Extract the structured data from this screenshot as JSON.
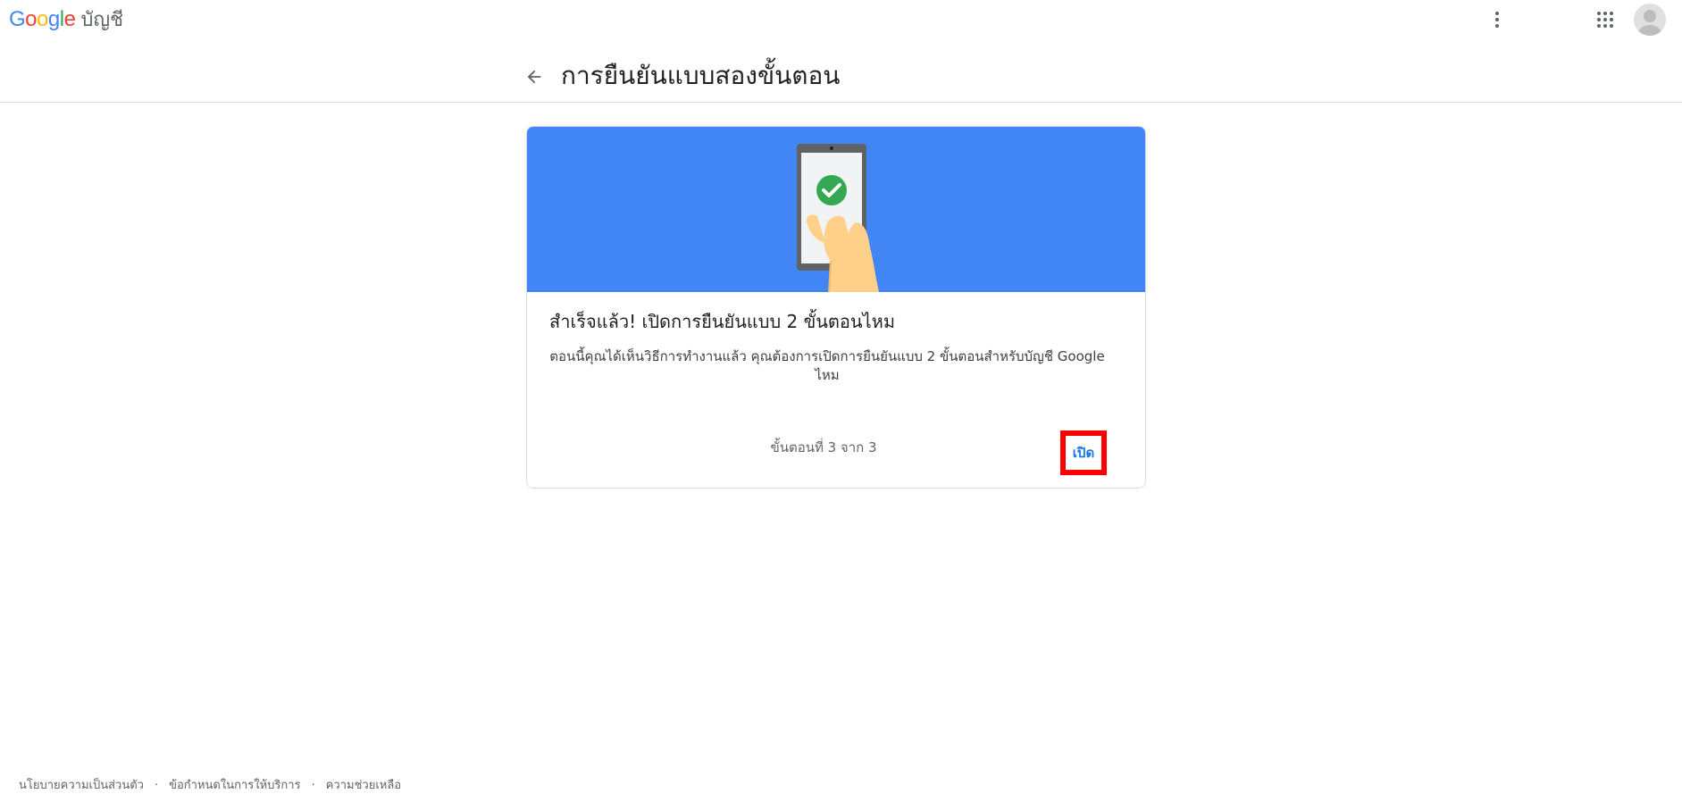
{
  "header": {
    "logo_text": "Google",
    "logo_letters": [
      "G",
      "o",
      "o",
      "g",
      "l",
      "e"
    ],
    "logo_colors": [
      "#4285f4",
      "#ea4335",
      "#fbbc05",
      "#4285f4",
      "#34a853",
      "#ea4335"
    ],
    "product_name": "บัญชี",
    "more_icon": "more-vert-icon",
    "apps_icon": "apps-grid-icon",
    "avatar_icon": "account-avatar-icon"
  },
  "title_bar": {
    "back_icon": "arrow-back-icon",
    "title": "การยืนยันแบบสองขั้นตอน"
  },
  "card": {
    "hero_color": "#4285f4",
    "hero_icon": "phone-checkmark-illustration",
    "heading": "สำเร็จแล้ว! เปิดการยืนยันแบบ 2 ขั้นตอนไหม",
    "body": "ตอนนี้คุณได้เห็นวิธีการทำงานแล้ว คุณต้องการเปิดการยืนยันแบบ 2 ขั้นตอนสำหรับบัญชี Google ไหม",
    "step_text": "ขั้นตอนที่ 3 จาก 3",
    "turn_on_label": "เปิด",
    "turn_on_color": "#1a73e8",
    "highlight_color": "#ff0000"
  },
  "footer": {
    "links": [
      "นโยบายความเป็นส่วนตัว",
      "ข้อกำหนดในการให้บริการ",
      "ความช่วยเหลือ"
    ],
    "separator": "·"
  }
}
